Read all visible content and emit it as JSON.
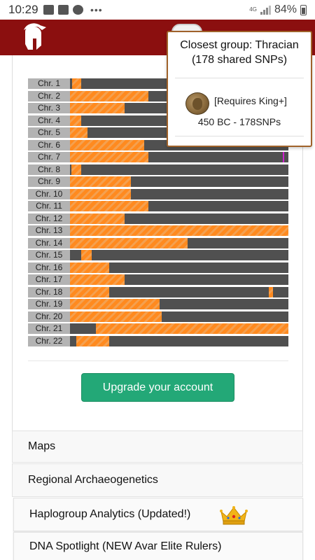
{
  "status_bar": {
    "time": "10:29",
    "network": "4G",
    "battery": "84%"
  },
  "popup": {
    "title_line1": "Closest group: Thracian",
    "title_line2": "(178 shared SNPs)",
    "requires": "[Requires King+]",
    "date_snps": "450 BC - 178SNPs"
  },
  "colors": {
    "header": "#8b0f0f",
    "match": "#ff8a1f",
    "background_track": "#505050",
    "button": "#23a877",
    "marker": "#d01fd0"
  },
  "chart_data": {
    "type": "bar",
    "categories": [
      "Chr. 1",
      "Chr. 2",
      "Chr. 3",
      "Chr. 4",
      "Chr. 5",
      "Chr. 6",
      "Chr. 7",
      "Chr. 8",
      "Chr. 9",
      "Chr. 10",
      "Chr. 11",
      "Chr. 12",
      "Chr. 13",
      "Chr. 14",
      "Chr. 15",
      "Chr. 16",
      "Chr. 17",
      "Chr. 18",
      "Chr. 19",
      "Chr. 20",
      "Chr. 21",
      "Chr. 22"
    ],
    "matched_segments_fraction": [
      [
        [
          0.01,
          0.05
        ]
      ],
      [
        [
          0.0,
          0.36
        ]
      ],
      [
        [
          0.0,
          0.25
        ]
      ],
      [
        [
          0.0,
          0.05
        ]
      ],
      [
        [
          0.0,
          0.08
        ]
      ],
      [
        [
          0.0,
          0.34
        ]
      ],
      [
        [
          0.0,
          0.36
        ]
      ],
      [
        [
          0.005,
          0.05
        ]
      ],
      [
        [
          0.0,
          0.28
        ]
      ],
      [
        [
          0.0,
          0.28
        ]
      ],
      [
        [
          0.0,
          0.36
        ]
      ],
      [
        [
          0.0,
          0.25
        ]
      ],
      [
        [
          0.0,
          1.0
        ]
      ],
      [
        [
          0.0,
          0.54
        ]
      ],
      [
        [
          0.05,
          0.1
        ]
      ],
      [
        [
          0.0,
          0.18
        ]
      ],
      [
        [
          0.0,
          0.25
        ]
      ],
      [
        [
          0.0,
          0.18
        ],
        [
          0.91,
          0.93
        ]
      ],
      [
        [
          0.0,
          0.41
        ]
      ],
      [
        [
          0.0,
          0.42
        ]
      ],
      [
        [
          0.12,
          1.0
        ]
      ],
      [
        [
          0.03,
          0.18
        ]
      ]
    ],
    "markers_fraction": [
      {
        "row": 6,
        "at": 0.975
      }
    ]
  },
  "actions": {
    "upgrade": "Upgrade your account"
  },
  "menu": [
    {
      "label": "Maps",
      "has_icon": false
    },
    {
      "label": "Regional Archaeogenetics",
      "has_icon": false
    },
    {
      "label": "Haplogroup Analytics (Updated!)",
      "has_icon": true,
      "icon": "crown-icon"
    },
    {
      "label": "DNA Spotlight (NEW Avar Elite Rulers)",
      "has_icon": false
    }
  ]
}
